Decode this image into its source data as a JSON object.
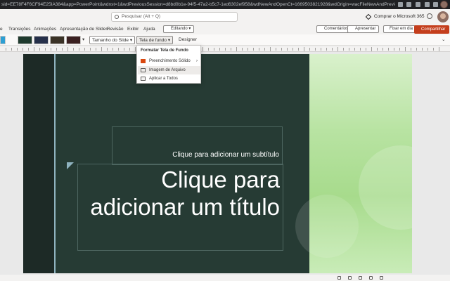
{
  "browser": {
    "url": "sid=EE78F4F6CF94E25IA384&app=PowerPoint&wdnst=1&wdPreviousSession=d8bd0b1e-94f5-47a2-b5c7-1ed6302ef958&wdNewAndOpenCt=1669503821928&wdOrigin=wacFileNewAndPreviousCorrelation=35ff7a2..."
  },
  "titlebar": {
    "search_placeholder": "Pesquisar (Alt + Q)",
    "buy_label": "Comprar o Microsoft 365"
  },
  "tabs": [
    {
      "label": "e"
    },
    {
      "label": "Transições"
    },
    {
      "label": "Animações"
    },
    {
      "label": "Apresentação de Slides"
    },
    {
      "label": "Revisão"
    },
    {
      "label": "Exibir"
    },
    {
      "label": "Ajuda"
    }
  ],
  "editing_label": "Editando",
  "actions": {
    "comments": "Comentários",
    "present": "Apresentar",
    "live": "Fixar em dia",
    "share": "Compartilhar"
  },
  "ribbon": {
    "slide_size": "Tamanho do Slide",
    "background": "Tela de fundo",
    "designer": "Designer"
  },
  "dropdown": {
    "header": "Formatar Tela de Fundo",
    "items": [
      {
        "label": "Preenchimento Sólido"
      },
      {
        "label": "Imagem de Arquivo"
      },
      {
        "label": "Aplicar a Todos"
      }
    ]
  },
  "slide": {
    "subtitle": "Clique para adicionar um subtítulo",
    "title": "Clique para adicionar um título"
  },
  "colors": {
    "share_button": "#c43e1c",
    "slide_background": "#263b34",
    "accent_bar": "#8fb3bf"
  }
}
